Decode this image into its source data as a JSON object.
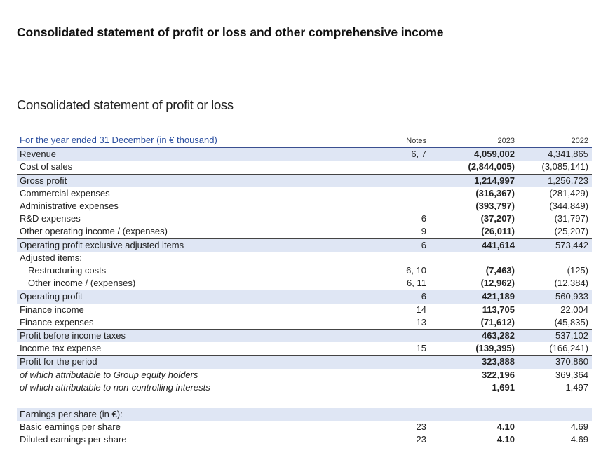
{
  "main_title": "Consolidated statement of profit or loss and other comprehensive income",
  "sub_title": "Consolidated statement of profit or loss",
  "table": {
    "header": {
      "label": "For the year ended 31 December (in € thousand)",
      "notes": "Notes",
      "y1": "2023",
      "y2": "2022"
    },
    "rows": [
      {
        "label": "Revenue",
        "notes": "6, 7",
        "y1": "4,059,002",
        "y2": "4,341,865",
        "shaded": true,
        "bb": false
      },
      {
        "label": "Cost of sales",
        "notes": "",
        "y1": "(2,844,005)",
        "y2": "(3,085,141)",
        "shaded": false,
        "bb": true
      },
      {
        "label": "Gross profit",
        "notes": "",
        "y1": "1,214,997",
        "y2": "1,256,723",
        "shaded": true,
        "bb": false
      },
      {
        "label": "Commercial expenses",
        "notes": "",
        "y1": "(316,367)",
        "y2": "(281,429)",
        "shaded": false,
        "bb": false
      },
      {
        "label": "Administrative expenses",
        "notes": "",
        "y1": "(393,797)",
        "y2": "(344,849)",
        "shaded": false,
        "bb": false
      },
      {
        "label": "R&D expenses",
        "notes": "6",
        "y1": "(37,207)",
        "y2": "(31,797)",
        "shaded": false,
        "bb": false
      },
      {
        "label": "Other operating income / (expenses)",
        "notes": "9",
        "y1": "(26,011)",
        "y2": "(25,207)",
        "shaded": false,
        "bb": true
      },
      {
        "label": "Operating profit exclusive adjusted items",
        "notes": "6",
        "y1": "441,614",
        "y2": "573,442",
        "shaded": true,
        "bb": false
      },
      {
        "label": "Adjusted items:",
        "notes": "",
        "y1": "",
        "y2": "",
        "shaded": false,
        "bb": false
      },
      {
        "label": "Restructuring costs",
        "notes": "6, 10",
        "y1": "(7,463)",
        "y2": "(125)",
        "shaded": false,
        "bb": false,
        "indent": true
      },
      {
        "label": "Other income / (expenses)",
        "notes": "6, 11",
        "y1": "(12,962)",
        "y2": "(12,384)",
        "shaded": false,
        "bb": true,
        "indent": true
      },
      {
        "label": "Operating profit",
        "notes": "6",
        "y1": "421,189",
        "y2": "560,933",
        "shaded": true,
        "bb": false
      },
      {
        "label": "Finance income",
        "notes": "14",
        "y1": "113,705",
        "y2": "22,004",
        "shaded": false,
        "bb": false
      },
      {
        "label": "Finance expenses",
        "notes": "13",
        "y1": "(71,612)",
        "y2": "(45,835)",
        "shaded": false,
        "bb": true
      },
      {
        "label": "Profit before income taxes",
        "notes": "",
        "y1": "463,282",
        "y2": "537,102",
        "shaded": true,
        "bb": false
      },
      {
        "label": "Income tax expense",
        "notes": "15",
        "y1": "(139,395)",
        "y2": "(166,241)",
        "shaded": false,
        "bb": true
      },
      {
        "label": "Profit for the period",
        "notes": "",
        "y1": "323,888",
        "y2": "370,860",
        "shaded": true,
        "bb": false
      },
      {
        "label": "of which attributable to Group equity holders",
        "notes": "",
        "y1": "322,196",
        "y2": "369,364",
        "shaded": false,
        "bb": false,
        "italic": true
      },
      {
        "label": "of which attributable to non-controlling interests",
        "notes": "",
        "y1": "1,691",
        "y2": "1,497",
        "shaded": false,
        "bb": false,
        "italic": true
      },
      {
        "spacer": true
      },
      {
        "label": "Earnings per share (in €):",
        "notes": "",
        "y1": "",
        "y2": "",
        "shaded": true,
        "bb": false
      },
      {
        "label": "Basic earnings per share",
        "notes": "23",
        "y1": "4.10",
        "y2": "4.69",
        "shaded": false,
        "bb": false
      },
      {
        "label": "Diluted earnings per share",
        "notes": "23",
        "y1": "4.10",
        "y2": "4.69",
        "shaded": false,
        "bb": false
      }
    ]
  }
}
